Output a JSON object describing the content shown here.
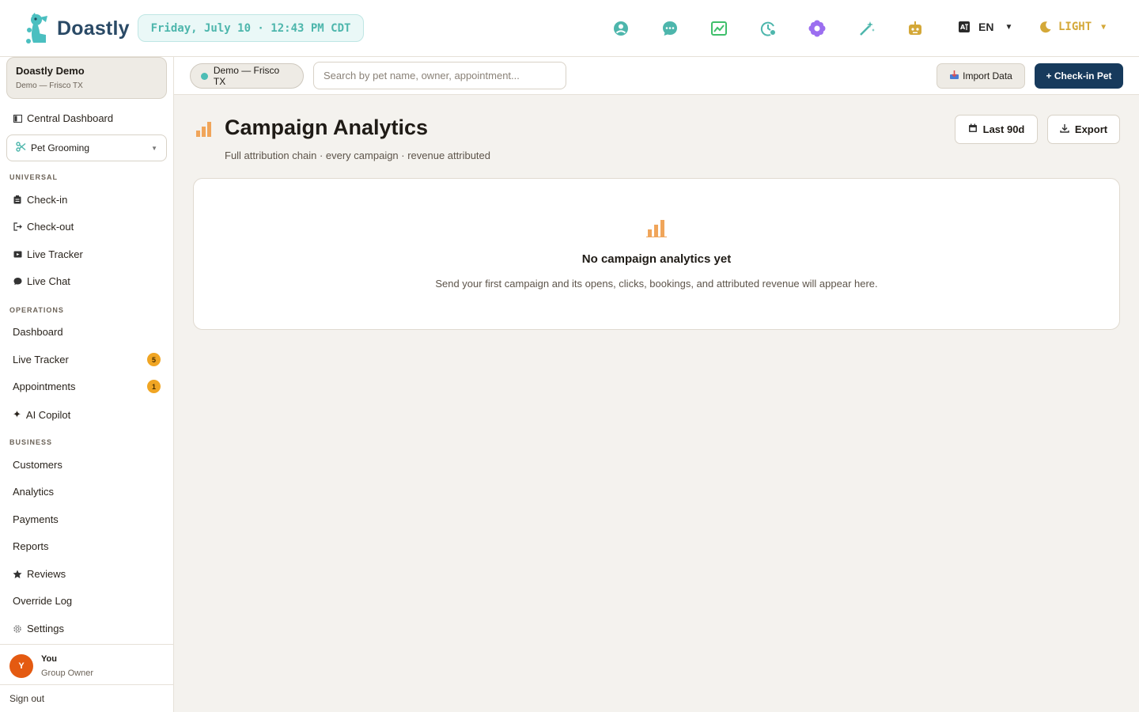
{
  "brand": {
    "name": "Doastly"
  },
  "header": {
    "datetime": "Friday, July 10 · 12:43 PM CDT",
    "icons": [
      "support-icon",
      "chat-icon",
      "chart-icon",
      "clock-icon",
      "flower-icon",
      "magic-wand-icon",
      "robot-icon"
    ],
    "language": "EN",
    "theme": "LIGHT"
  },
  "sidebar": {
    "org": {
      "name": "Doastly Demo",
      "location": "Demo — Frisco TX"
    },
    "central_dashboard": "Central Dashboard",
    "vertical": "Pet Grooming",
    "sections": {
      "universal": "UNIVERSAL",
      "operations": "OPERATIONS",
      "business": "BUSINESS"
    },
    "universal_items": [
      "Check-in",
      "Check-out",
      "Live Tracker",
      "Live Chat"
    ],
    "operations_items": [
      {
        "label": "Dashboard"
      },
      {
        "label": "Live Tracker",
        "badge": "5"
      },
      {
        "label": "Appointments",
        "badge": "1"
      },
      {
        "label": "AI Copilot"
      }
    ],
    "business_items": [
      "Customers",
      "Analytics",
      "Payments",
      "Reports",
      "Reviews",
      "Override Log",
      "Settings"
    ],
    "user": {
      "initial": "Y",
      "name": "You",
      "role": "Group Owner"
    },
    "signout": "Sign out"
  },
  "subheader": {
    "location": "Demo — Frisco TX",
    "search_placeholder": "Search by pet name, owner, appointment...",
    "import_label": "Import Data",
    "checkin_label": "+ Check-in Pet"
  },
  "page": {
    "title": "Campaign Analytics",
    "subtitle": "Full attribution chain · every campaign · revenue attributed",
    "range_label": "Last 90d",
    "export_label": "Export"
  },
  "empty_state": {
    "title": "No campaign analytics yet",
    "message": "Send your first campaign and its opens, clicks, bookings, and attributed revenue will appear here."
  },
  "colors": {
    "accent_teal": "#4db6ac",
    "primary_navy": "#173a5c",
    "badge_orange": "#f0a523",
    "chart_orange": "#f0a55a"
  }
}
